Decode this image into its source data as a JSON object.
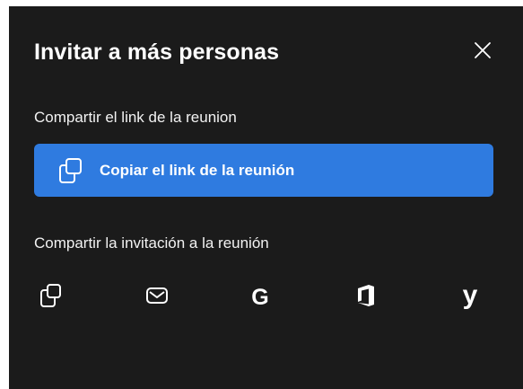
{
  "dialog": {
    "title": "Invitar a más personas",
    "close_icon": "close-icon"
  },
  "link_section": {
    "label": "Compartir el link de la reunion",
    "copy_button_label": "Copiar el link de la reunión",
    "copy_button_icon": "copy-icon",
    "button_color": "#2f7be0"
  },
  "invite_section": {
    "label": "Compartir la invitación a la reunión",
    "options": [
      {
        "name": "copy-invite",
        "icon": "copy-icon"
      },
      {
        "name": "email",
        "icon": "mail-icon"
      },
      {
        "name": "google",
        "icon": "google-icon",
        "glyph": "G"
      },
      {
        "name": "office",
        "icon": "office-icon"
      },
      {
        "name": "yahoo",
        "icon": "yahoo-icon",
        "glyph": "y"
      }
    ]
  },
  "colors": {
    "background": "#1b1b1b",
    "text": "#ffffff"
  }
}
